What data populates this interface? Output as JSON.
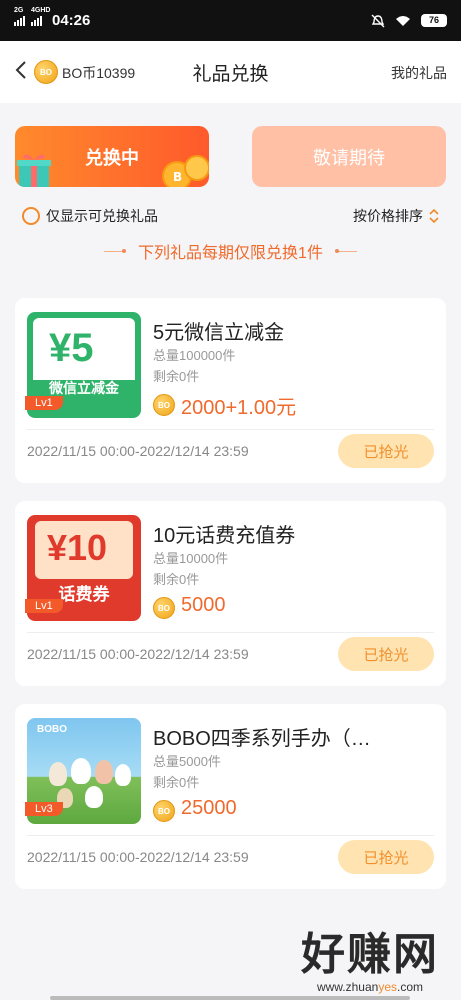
{
  "status_bar": {
    "network1": "2G",
    "network2": "4GHD",
    "time": "04:26",
    "battery": "76"
  },
  "header": {
    "back_icon": "chevron-left-icon",
    "coin_icon_text": "BO",
    "balance": "BO币10399",
    "title": "礼品兑换",
    "my_gifts": "我的礼品"
  },
  "tabs": [
    {
      "label": "兑换中",
      "active": true
    },
    {
      "label": "敬请期待",
      "active": false
    }
  ],
  "filter": {
    "only_exchangeable": "仅显示可兑换礼品",
    "sort": "按价格排序"
  },
  "notice": "下列礼品每期仅限兑换1件",
  "gifts": [
    {
      "title": "5元微信立减金",
      "total": "总量100000件",
      "remaining": "剩余0件",
      "price": "2000+1.00元",
      "period": "2022/11/15 00:00-2022/12/14 23:59",
      "button": "已抢光",
      "level": "Lv1",
      "thumb_big": "¥5",
      "thumb_label": "微信立减金"
    },
    {
      "title": "10元话费充值券",
      "total": "总量10000件",
      "remaining": "剩余0件",
      "price": "5000",
      "period": "2022/11/15 00:00-2022/12/14 23:59",
      "button": "已抢光",
      "level": "Lv1",
      "thumb_big": "¥10",
      "thumb_label": "话费券"
    },
    {
      "title": "BOBO四季系列手办（…",
      "total": "总量5000件",
      "remaining": "剩余0件",
      "price": "25000",
      "period": "2022/11/15 00:00-2022/12/14 23:59",
      "button": "已抢光",
      "level": "Lv3",
      "thumb_brand": "BOBO"
    }
  ],
  "watermark": {
    "big": "好赚网",
    "small_prefix": "www.zhuan",
    "small_accent": "yes",
    "small_suffix": ".com"
  },
  "colors": {
    "accent": "#f06a2c",
    "tab_active": "#ff5a2b",
    "tab_pending": "#ffc0a5",
    "sold_bg": "#ffe3b0"
  }
}
